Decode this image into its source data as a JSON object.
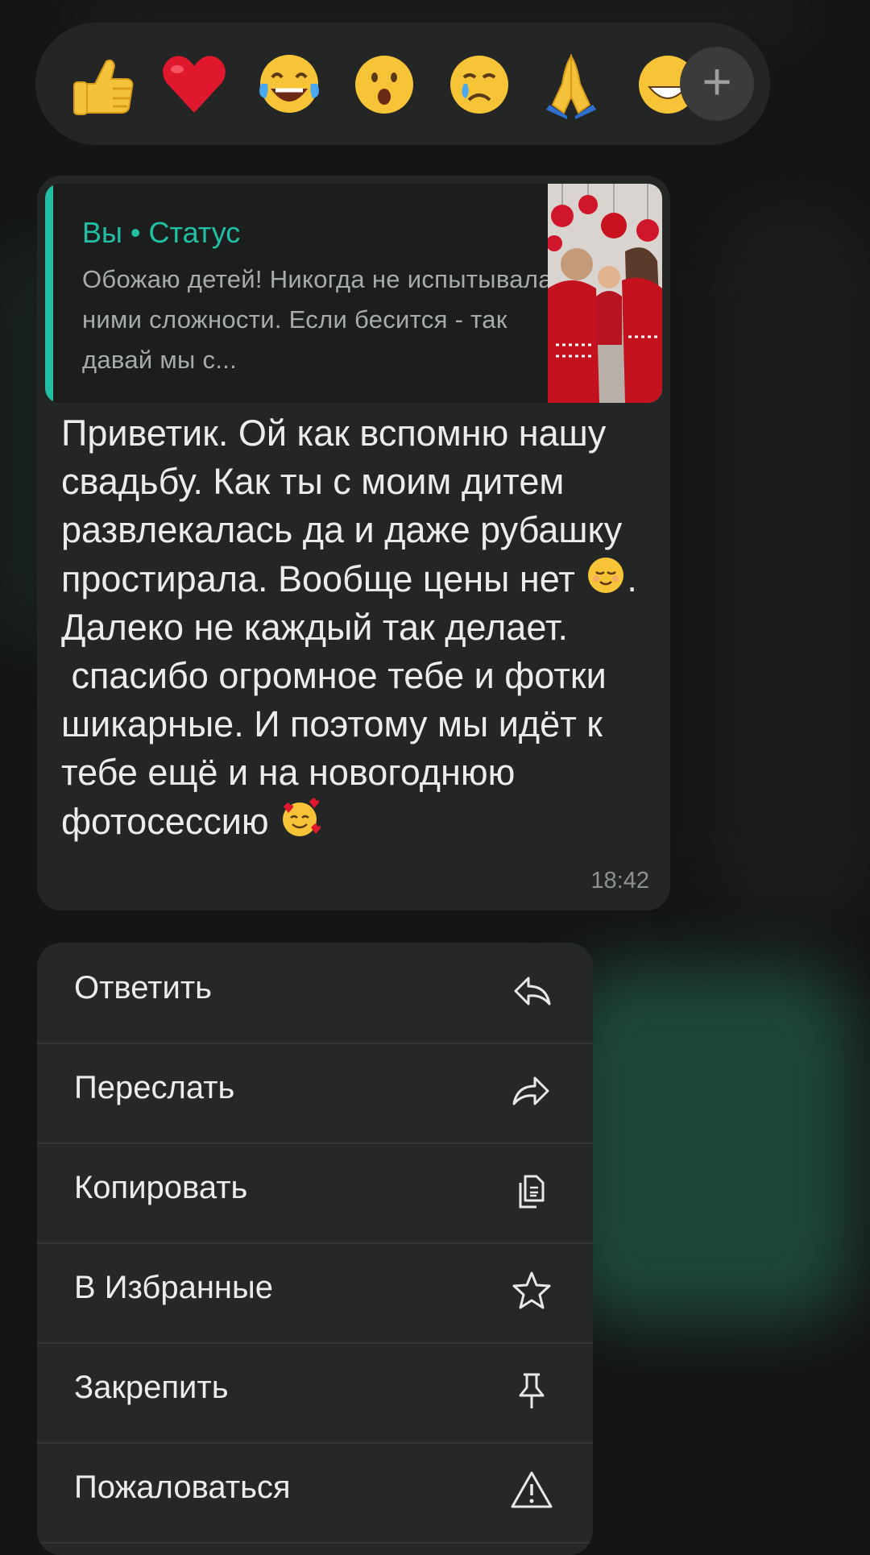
{
  "reactions": [
    {
      "name": "thumbs-up",
      "glyph": "👍"
    },
    {
      "name": "red-heart",
      "glyph": "❤️"
    },
    {
      "name": "tears-of-joy",
      "glyph": "😂"
    },
    {
      "name": "surprised-face",
      "glyph": "😮"
    },
    {
      "name": "crying-face",
      "glyph": "😢"
    },
    {
      "name": "folded-hands",
      "glyph": "🙏"
    },
    {
      "name": "grinning-face",
      "glyph": "😁"
    }
  ],
  "add_reaction_label": "+",
  "message": {
    "quote": {
      "title": "Вы • Статус",
      "text": "Обожаю детей! Никогда не испытывала с ними сложности. Если бесится - так давай мы с..."
    },
    "body_part1": "Приветик. Ой как вспомню нашу свадьбу. Как ты с моим дитем развлекалась да и даже рубашку простирала. Вообще цены нет ",
    "body_part2": ". Далеко не каждый так делает.\n спасибо огромное тебе и фотки шикарные. И поэтому мы идёт к тебе ещё и на новогоднюю фотосессию ",
    "time": "18:42"
  },
  "menu": {
    "items": [
      {
        "label": "Ответить",
        "icon": "reply-icon"
      },
      {
        "label": "Переслать",
        "icon": "forward-icon"
      },
      {
        "label": "Копировать",
        "icon": "copy-icon"
      },
      {
        "label": "В Избранные",
        "icon": "star-icon"
      },
      {
        "label": "Закрепить",
        "icon": "pin-icon"
      },
      {
        "label": "Пожаловаться",
        "icon": "warning-icon"
      }
    ]
  },
  "colors": {
    "accent": "#21c0a5",
    "bubble": "#242626",
    "menu": "#262828",
    "background": "#141515"
  }
}
